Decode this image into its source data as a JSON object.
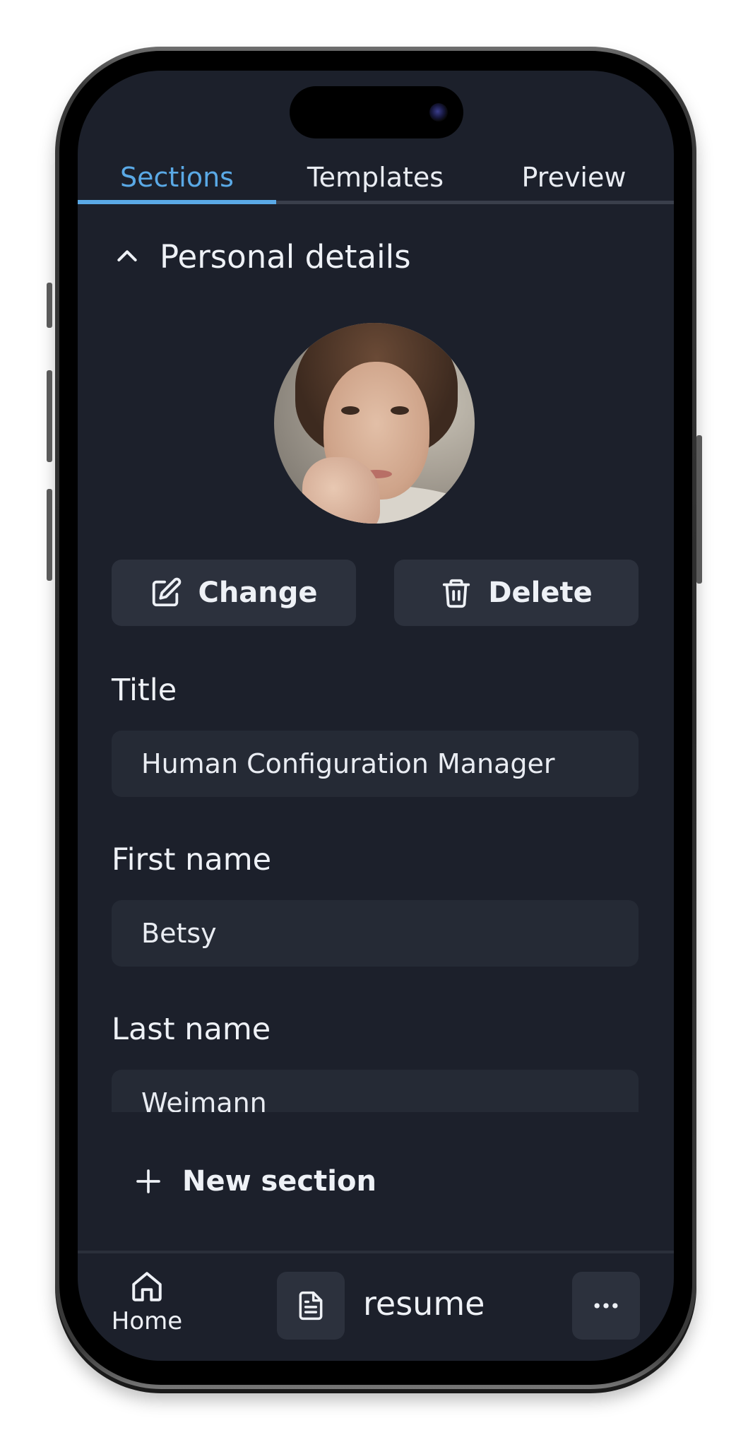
{
  "tabs": [
    {
      "label": "Sections",
      "active": true
    },
    {
      "label": "Templates",
      "active": false
    },
    {
      "label": "Preview",
      "active": false
    }
  ],
  "section": {
    "title": "Personal details",
    "toggle_icon": "chevron-up-icon"
  },
  "photo": {
    "change_label": "Change",
    "change_icon": "edit-icon",
    "delete_label": "Delete",
    "delete_icon": "trash-icon"
  },
  "fields": {
    "title": {
      "label": "Title",
      "value": "Human Configuration Manager"
    },
    "first_name": {
      "label": "First name",
      "value": "Betsy"
    },
    "last_name": {
      "label": "Last name",
      "value": "Weimann"
    }
  },
  "new_section": {
    "label": "New section",
    "icon": "plus-icon"
  },
  "bottom_bar": {
    "home_label": "Home",
    "home_icon": "home-icon",
    "document_icon": "document-icon",
    "document_name": "resume",
    "more_icon": "more-horizontal-icon"
  },
  "colors": {
    "background": "#1c202b",
    "accent": "#5aa9e6",
    "surface": "#2c313d",
    "input": "#252a35",
    "text": "#eef1f6"
  }
}
